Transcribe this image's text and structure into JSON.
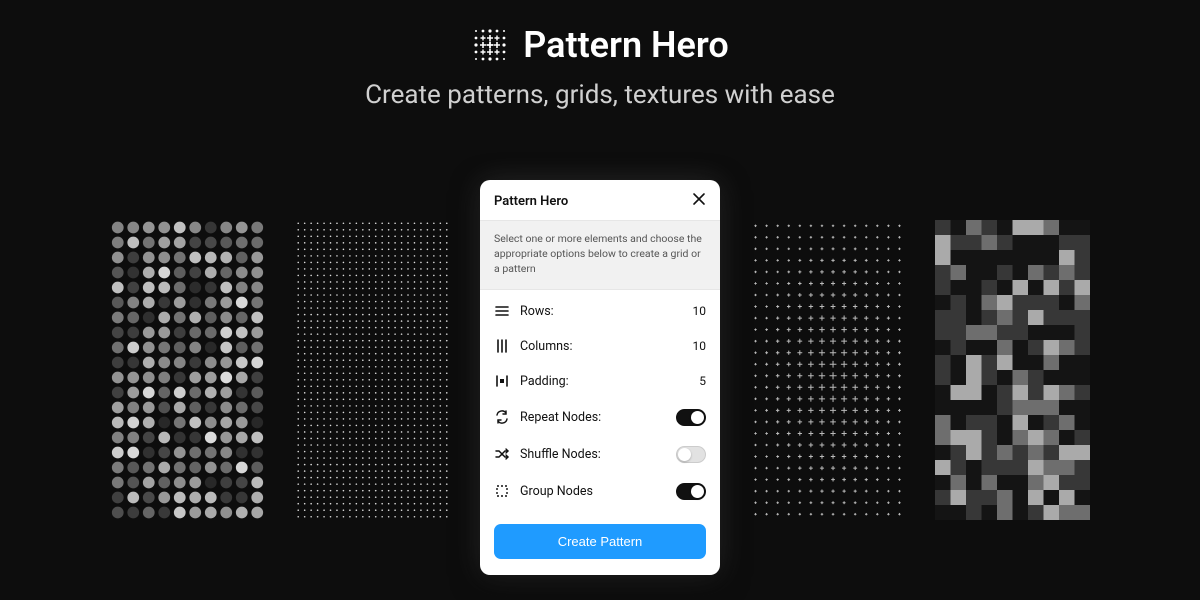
{
  "brand": {
    "name": "Pattern Hero"
  },
  "tagline": "Create patterns, grids, textures with ease",
  "panel": {
    "title": "Pattern Hero",
    "description": "Select one or more elements and choose the appropriate options below to create a grid or a pattern",
    "rows_label": "Rows:",
    "rows_value": "10",
    "columns_label": "Columns:",
    "columns_value": "10",
    "padding_label": "Padding:",
    "padding_value": "5",
    "repeat_label": "Repeat Nodes:",
    "repeat_on": true,
    "shuffle_label": "Shuffle Nodes:",
    "shuffle_on": false,
    "group_label": "Group Nodes",
    "group_on": true,
    "cta": "Create Pattern"
  }
}
